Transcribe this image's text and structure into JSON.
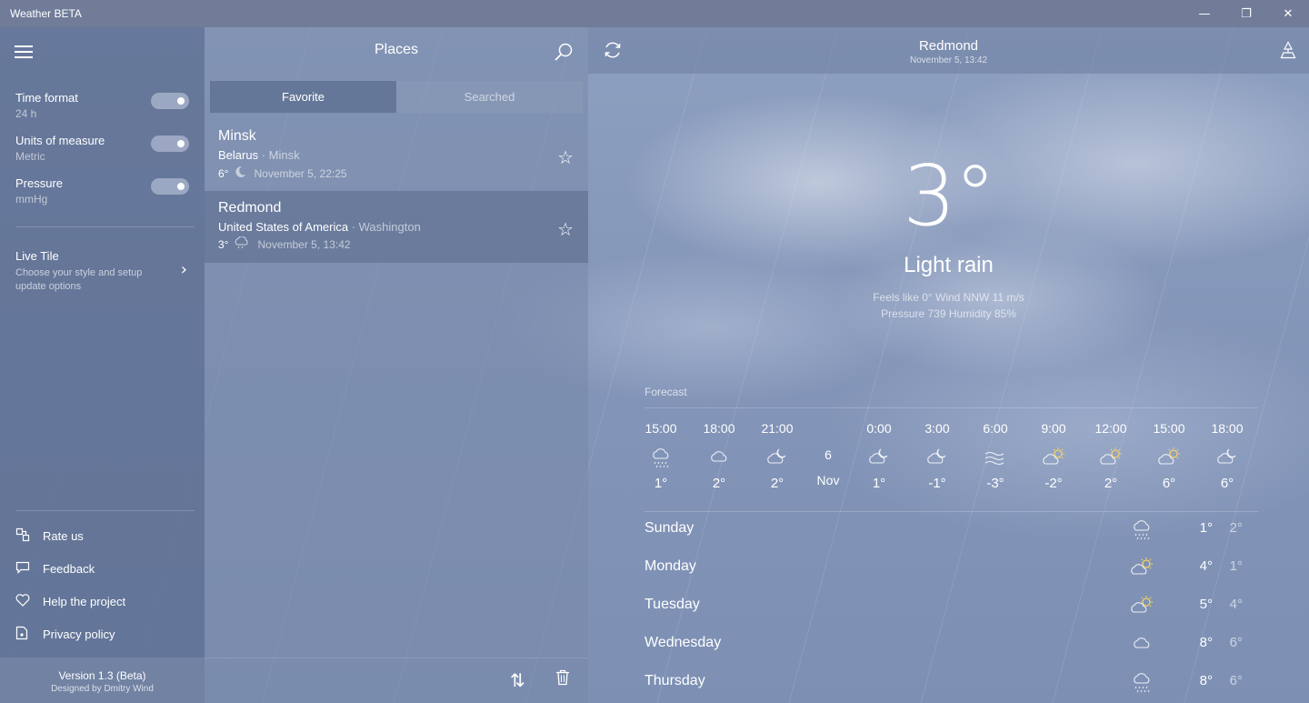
{
  "app": {
    "title": "Weather BETA"
  },
  "window_controls": {
    "minimize": "—",
    "maximize": "❐",
    "close": "✕"
  },
  "settings": {
    "items": [
      {
        "label": "Time format",
        "value": "24 h",
        "enabled": true
      },
      {
        "label": "Units of measure",
        "value": "Metric",
        "enabled": true
      },
      {
        "label": "Pressure",
        "value": "mmHg",
        "enabled": true
      }
    ],
    "live_tile": {
      "label": "Live Tile",
      "description": "Choose your style and setup update options"
    },
    "menu": [
      {
        "label": "Rate us",
        "icon": "rate-icon"
      },
      {
        "label": "Feedback",
        "icon": "feedback-icon"
      },
      {
        "label": "Help the project",
        "icon": "heart-icon"
      },
      {
        "label": "Privacy policy",
        "icon": "privacy-icon"
      }
    ],
    "version": "Version 1.3 (Beta)",
    "designer": "Designed by Dmitry Wind"
  },
  "places": {
    "title": "Places",
    "tabs": [
      {
        "label": "Favorite",
        "active": true
      },
      {
        "label": "Searched",
        "active": false
      }
    ],
    "list": [
      {
        "city": "Minsk",
        "country": "Belarus",
        "region": "Minsk",
        "temp": "6°",
        "icon": "moon-icon",
        "datetime": "November 5, 22:25",
        "selected": false
      },
      {
        "city": "Redmond",
        "country": "United States of America",
        "region": "Washington",
        "temp": "3°",
        "icon": "rain-cloud-icon",
        "datetime": "November 5, 13:42",
        "selected": true
      }
    ]
  },
  "header": {
    "city": "Redmond",
    "datetime": "November 5, 13:42"
  },
  "current": {
    "temp": "3°",
    "condition": "Light rain",
    "details_line1": "Feels like 0°  Wind NNW 11 m/s",
    "details_line2": "Pressure 739  Humidity 85%"
  },
  "forecast": {
    "label": "Forecast",
    "day_marker": {
      "day": "6",
      "month": "Nov"
    },
    "hourly": [
      {
        "time": "15:00",
        "temp": "1°",
        "icon": "rain-icon"
      },
      {
        "time": "18:00",
        "temp": "2°",
        "icon": "cloud-icon"
      },
      {
        "time": "21:00",
        "temp": "2°",
        "icon": "cloud-moon-icon"
      },
      {
        "time": "0:00",
        "temp": "1°",
        "icon": "cloud-moon-icon"
      },
      {
        "time": "3:00",
        "temp": "-1°",
        "icon": "cloud-moon-icon"
      },
      {
        "time": "6:00",
        "temp": "-3°",
        "icon": "fog-icon"
      },
      {
        "time": "9:00",
        "temp": "-2°",
        "icon": "cloud-sun-icon"
      },
      {
        "time": "12:00",
        "temp": "2°",
        "icon": "cloud-sun-icon"
      },
      {
        "time": "15:00",
        "temp": "6°",
        "icon": "cloud-sun-icon"
      },
      {
        "time": "18:00",
        "temp": "6°",
        "icon": "cloud-moon-icon"
      }
    ],
    "daily": [
      {
        "day": "Sunday",
        "hi": "1°",
        "lo": "2°",
        "icon": "rain-icon"
      },
      {
        "day": "Monday",
        "hi": "4°",
        "lo": "1°",
        "icon": "cloud-sun-icon"
      },
      {
        "day": "Tuesday",
        "hi": "5°",
        "lo": "4°",
        "icon": "cloud-sun-icon"
      },
      {
        "day": "Wednesday",
        "hi": "8°",
        "lo": "6°",
        "icon": "cloud-icon"
      },
      {
        "day": "Thursday",
        "hi": "8°",
        "lo": "6°",
        "icon": "rain-icon"
      }
    ]
  },
  "colors": {
    "sun": "#f2d36b",
    "accent": "#5c6e91"
  }
}
